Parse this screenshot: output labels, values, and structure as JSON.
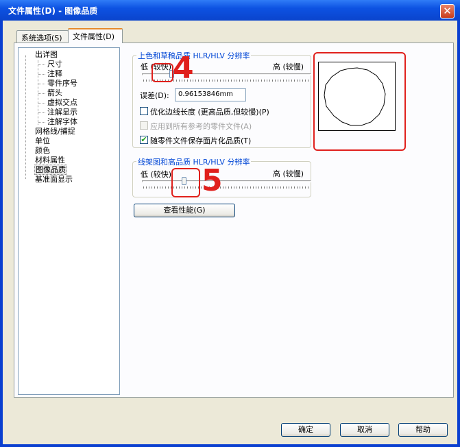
{
  "window": {
    "title": "文件属性(D) - 图像品质",
    "close_glyph": "✕"
  },
  "tabs": [
    {
      "label": "系统选项(S)",
      "active": false
    },
    {
      "label": "文件属性(D)",
      "active": true
    }
  ],
  "tree": {
    "items": [
      {
        "label": "出详图",
        "level": 0
      },
      {
        "label": "尺寸",
        "level": 1
      },
      {
        "label": "注释",
        "level": 1
      },
      {
        "label": "零件序号",
        "level": 1
      },
      {
        "label": "箭头",
        "level": 1
      },
      {
        "label": "虚拟交点",
        "level": 1
      },
      {
        "label": "注解显示",
        "level": 1
      },
      {
        "label": "注解字体",
        "level": 1
      },
      {
        "label": "网格线/捕捉",
        "level": 0
      },
      {
        "label": "单位",
        "level": 0
      },
      {
        "label": "颜色",
        "level": 0
      },
      {
        "label": "材料属性",
        "level": 0
      },
      {
        "label": "图像品质",
        "level": 0,
        "selected": true
      },
      {
        "label": "基准面显示",
        "level": 0
      }
    ]
  },
  "shaded_group": {
    "legend": "上色和草稿品质 HLR/HLV 分辨率",
    "low_label": "低 (较快)",
    "high_label": "高 (较慢)",
    "slider_fraction": 0.17,
    "deviation_label": "误差(D):",
    "deviation_value": "0.96153846mm",
    "optimize_label": "优化边线长度 (更高品质,但较慢)(P)",
    "optimize_checked": false,
    "apply_all_label": "应用到所有参考的零件文件(A)",
    "apply_all_checked": false,
    "apply_all_disabled": true,
    "save_tess_label": "随零件文件保存面片化品质(T)",
    "save_tess_checked": true
  },
  "wireframe_group": {
    "legend": "线架图和高品质 HLR/HLV 分辨率",
    "low_label": "低 (较快)",
    "high_label": "高 (较慢)",
    "slider_fraction": 0.24
  },
  "performance_button": "查看性能(G)",
  "annotations": {
    "marker_4": "4",
    "marker_5": "5"
  },
  "footer": {
    "ok": "确定",
    "cancel": "取消",
    "help": "帮助"
  },
  "colors": {
    "title_bar": "#0a44cc",
    "annotation": "#e0201c",
    "legend_text": "#0046d5"
  }
}
